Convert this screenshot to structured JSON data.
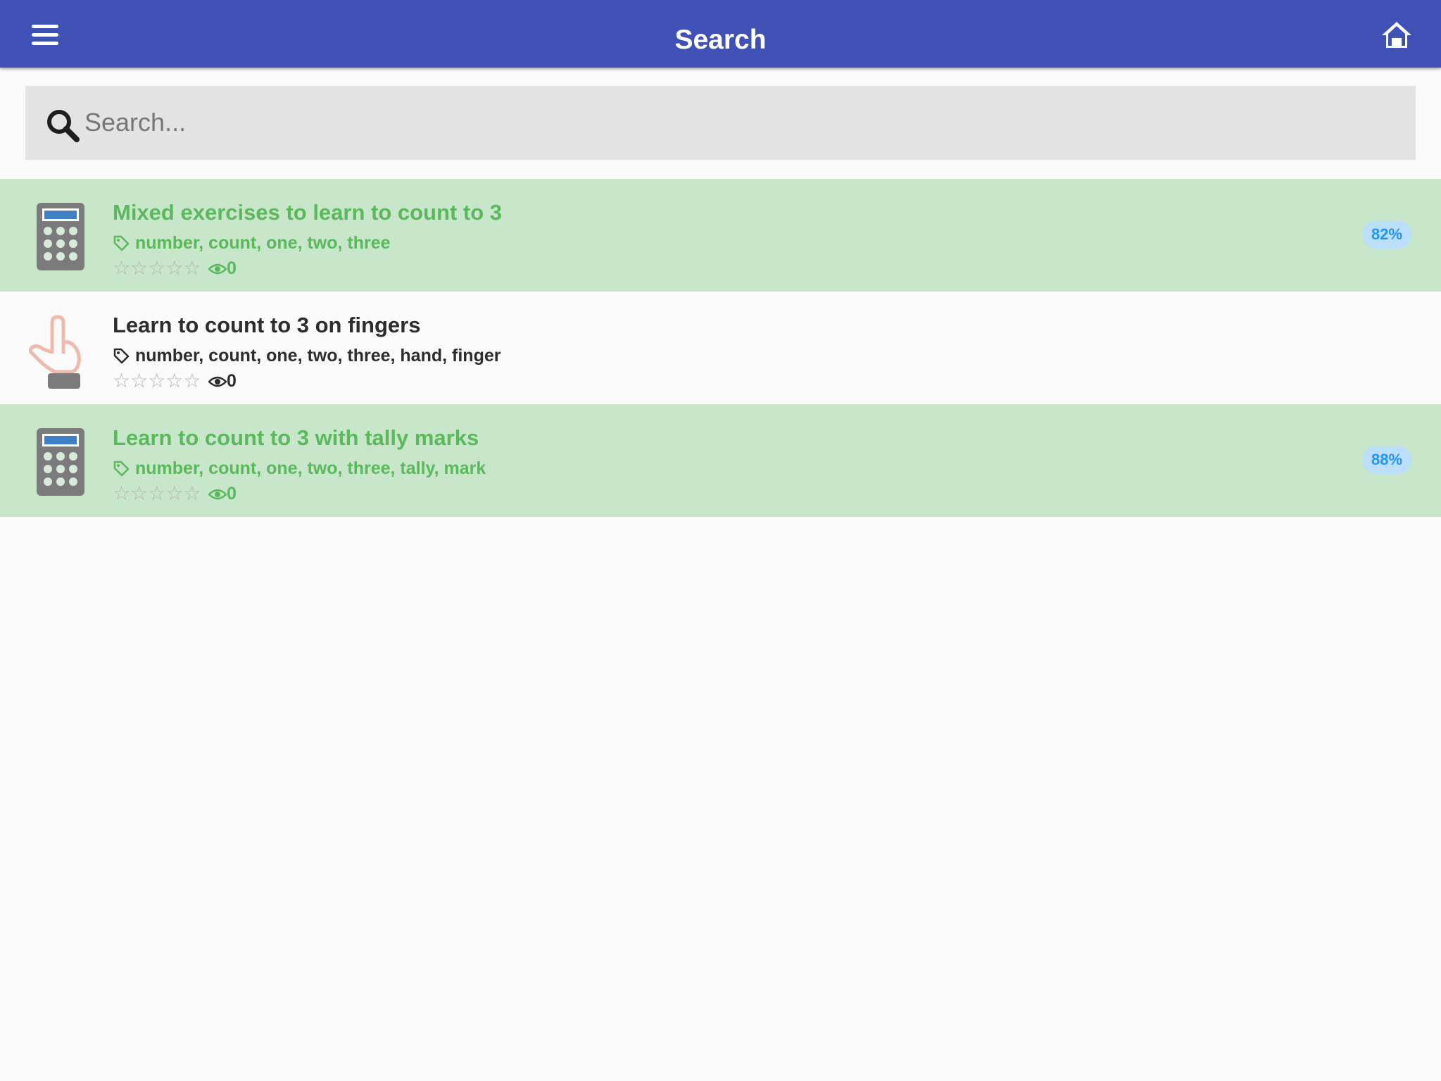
{
  "header": {
    "title": "Search",
    "menu_icon": "hamburger-menu-icon",
    "home_icon": "home-icon"
  },
  "search": {
    "placeholder": "Search...",
    "value": "",
    "icon": "magnifier-icon"
  },
  "results": [
    {
      "title": "Mixed exercises to learn to count to 3",
      "tags": "number, count, one, two, three",
      "rating": 0,
      "stars": "☆☆☆☆☆",
      "views": "0",
      "score": "82%",
      "completed": true,
      "icon": "calculator-icon"
    },
    {
      "title": "Learn to count to 3 on fingers",
      "tags": "number, count, one, two, three, hand, finger",
      "rating": 0,
      "stars": "☆☆☆☆☆",
      "views": "0",
      "score": "",
      "completed": false,
      "icon": "pointing-hand-icon"
    },
    {
      "title": "Learn to count to 3 with tally marks",
      "tags": "number, count, one, two, three, tally, mark",
      "rating": 0,
      "stars": "☆☆☆☆☆",
      "views": "0",
      "score": "88%",
      "completed": true,
      "icon": "calculator-icon"
    }
  ],
  "colors": {
    "header_bg": "#3f51b5",
    "completed_row_bg": "#c8e6c9",
    "completed_text": "#5cb85c",
    "badge_bg": "#bbdefb",
    "badge_text": "#2196f3",
    "search_bg": "#e3e3e3"
  }
}
